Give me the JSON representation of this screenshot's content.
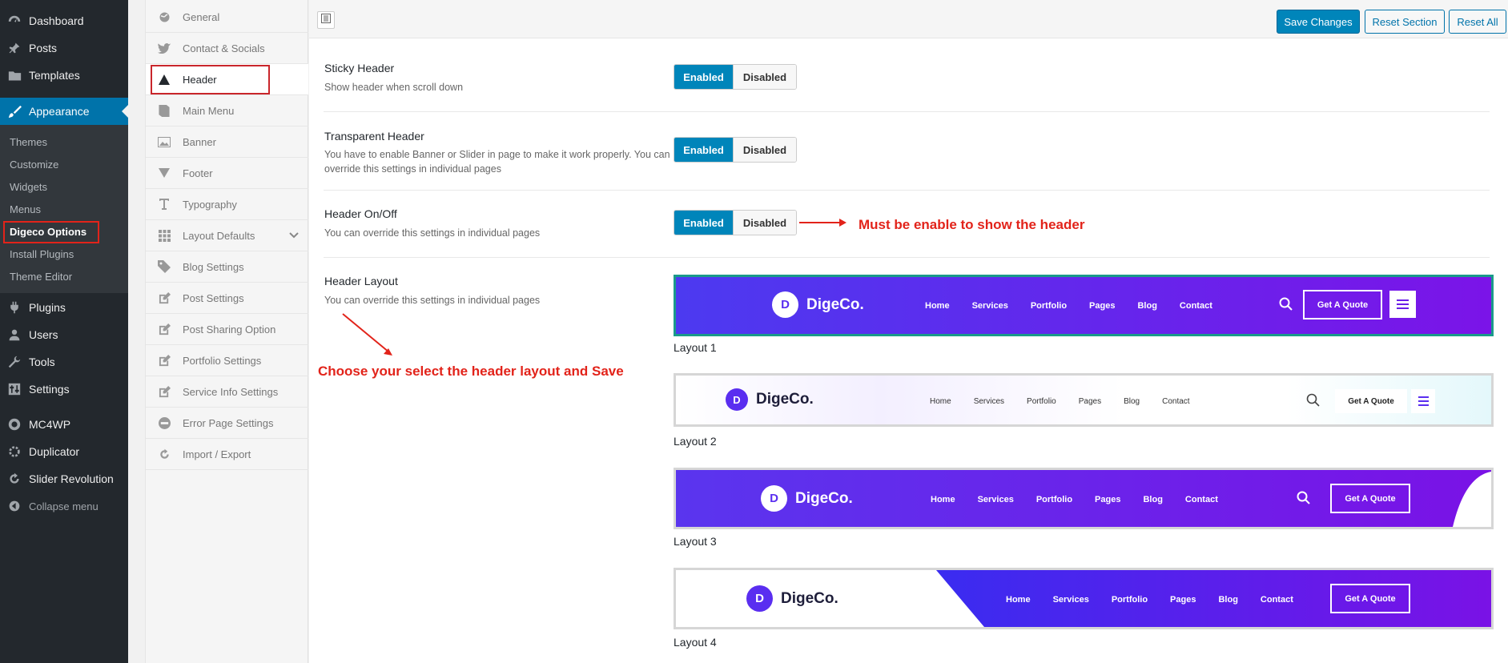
{
  "admin_menu": {
    "items": [
      {
        "label": "Dashboard",
        "icon": "dashboard-icon"
      },
      {
        "label": "Posts",
        "icon": "pin-icon"
      },
      {
        "label": "Templates",
        "icon": "folder-icon"
      },
      {
        "label": "Appearance",
        "icon": "brush-icon"
      }
    ],
    "submenu": [
      "Themes",
      "Customize",
      "Widgets",
      "Menus",
      "Digeco Options",
      "Install Plugins",
      "Theme Editor"
    ],
    "lower_items": [
      {
        "label": "Plugins",
        "icon": "plug-icon"
      },
      {
        "label": "Users",
        "icon": "user-icon"
      },
      {
        "label": "Tools",
        "icon": "wrench-icon"
      },
      {
        "label": "Settings",
        "icon": "settings-icon"
      },
      {
        "label": "MC4WP",
        "icon": "mc4wp-icon"
      },
      {
        "label": "Duplicator",
        "icon": "duplicator-icon"
      },
      {
        "label": "Slider Revolution",
        "icon": "refresh-icon"
      }
    ],
    "collapse": "Collapse menu"
  },
  "option_tabs": [
    {
      "label": "General",
      "icon": "globe-icon"
    },
    {
      "label": "Contact & Socials",
      "icon": "twitter-icon"
    },
    {
      "label": "Header",
      "icon": "triangle-icon"
    },
    {
      "label": "Main Menu",
      "icon": "book-icon"
    },
    {
      "label": "Banner",
      "icon": "image-icon"
    },
    {
      "label": "Footer",
      "icon": "triangle-down-icon"
    },
    {
      "label": "Typography",
      "icon": "text-icon"
    },
    {
      "label": "Layout Defaults",
      "icon": "grid-icon"
    },
    {
      "label": "Blog Settings",
      "icon": "tag-icon"
    },
    {
      "label": "Post Settings",
      "icon": "edit-icon"
    },
    {
      "label": "Post Sharing Option",
      "icon": "edit-icon"
    },
    {
      "label": "Portfolio Settings",
      "icon": "edit-icon"
    },
    {
      "label": "Service Info Settings",
      "icon": "edit-icon"
    },
    {
      "label": "Error Page Settings",
      "icon": "minus-circle-icon"
    },
    {
      "label": "Import / Export",
      "icon": "refresh-icon"
    }
  ],
  "toolbar": {
    "save": "Save Changes",
    "reset_section": "Reset Section",
    "reset_all": "Reset All"
  },
  "fields": {
    "sticky": {
      "title": "Sticky Header",
      "desc": "Show header when scroll down"
    },
    "transparent": {
      "title": "Transparent Header",
      "desc": "You have to enable Banner or Slider in page to make it work properly. You can override this settings in individual pages"
    },
    "onoff": {
      "title": "Header On/Off",
      "desc": "You can override this settings in individual pages"
    },
    "layout": {
      "title": "Header Layout",
      "desc": "You can override this settings in individual pages"
    }
  },
  "toggle": {
    "enabled": "Enabled",
    "disabled": "Disabled"
  },
  "annotations": {
    "must_enable": "Must be enable to show the header",
    "choose_layout": "Choose your select the header layout and Save"
  },
  "preview": {
    "brand": "DigeCo.",
    "nav": [
      "Home",
      "Services",
      "Portfolio",
      "Pages",
      "Blog",
      "Contact"
    ],
    "quote": "Get A Quote"
  },
  "layouts": [
    "Layout 1",
    "Layout 2",
    "Layout 3",
    "Layout 4"
  ],
  "colors": {
    "wp_blue": "#0085ba",
    "sidebar": "#23282d",
    "purple": "#6a1ee8",
    "annotation_red": "#e2231a"
  }
}
